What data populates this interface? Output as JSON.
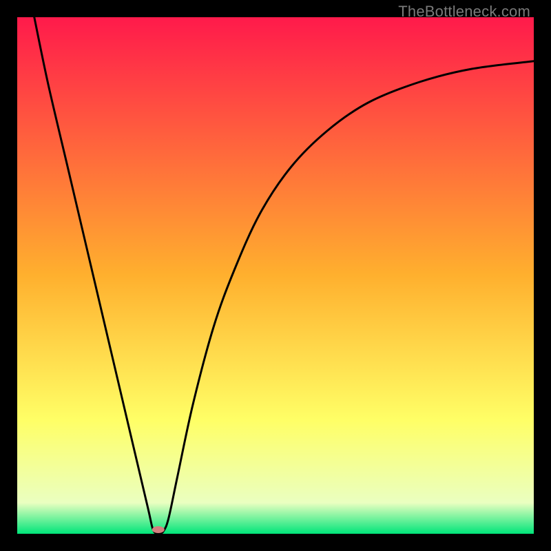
{
  "watermark": "TheBottleneck.com",
  "chart_data": {
    "type": "line",
    "title": "",
    "xlabel": "",
    "ylabel": "",
    "xlim": [
      0,
      100
    ],
    "ylim": [
      0,
      100
    ],
    "background_gradient": {
      "stops": [
        {
          "pos": 0.0,
          "color": "#ff1a4b"
        },
        {
          "pos": 0.5,
          "color": "#ffb02e"
        },
        {
          "pos": 0.78,
          "color": "#ffff66"
        },
        {
          "pos": 0.94,
          "color": "#eaffc0"
        },
        {
          "pos": 1.0,
          "color": "#00e57a"
        }
      ]
    },
    "series": [
      {
        "name": "curve",
        "points": [
          {
            "x": 3.3,
            "y": 100.0
          },
          {
            "x": 6.0,
            "y": 87.0
          },
          {
            "x": 10.0,
            "y": 70.0
          },
          {
            "x": 14.0,
            "y": 53.0
          },
          {
            "x": 18.0,
            "y": 36.0
          },
          {
            "x": 22.0,
            "y": 19.0
          },
          {
            "x": 25.3,
            "y": 5.0
          },
          {
            "x": 26.3,
            "y": 0.8
          },
          {
            "x": 27.3,
            "y": 0.0
          },
          {
            "x": 28.3,
            "y": 0.5
          },
          {
            "x": 29.3,
            "y": 3.0
          },
          {
            "x": 31.0,
            "y": 11.0
          },
          {
            "x": 34.0,
            "y": 25.0
          },
          {
            "x": 38.0,
            "y": 40.0
          },
          {
            "x": 42.0,
            "y": 51.0
          },
          {
            "x": 47.0,
            "y": 62.0
          },
          {
            "x": 53.0,
            "y": 71.0
          },
          {
            "x": 60.0,
            "y": 78.0
          },
          {
            "x": 68.0,
            "y": 83.5
          },
          {
            "x": 78.0,
            "y": 87.5
          },
          {
            "x": 88.0,
            "y": 90.0
          },
          {
            "x": 100.0,
            "y": 91.5
          }
        ]
      }
    ],
    "marker": {
      "x": 27.3,
      "y": 0.8,
      "color": "#d47f7f",
      "rx": 9,
      "ry": 5
    }
  }
}
